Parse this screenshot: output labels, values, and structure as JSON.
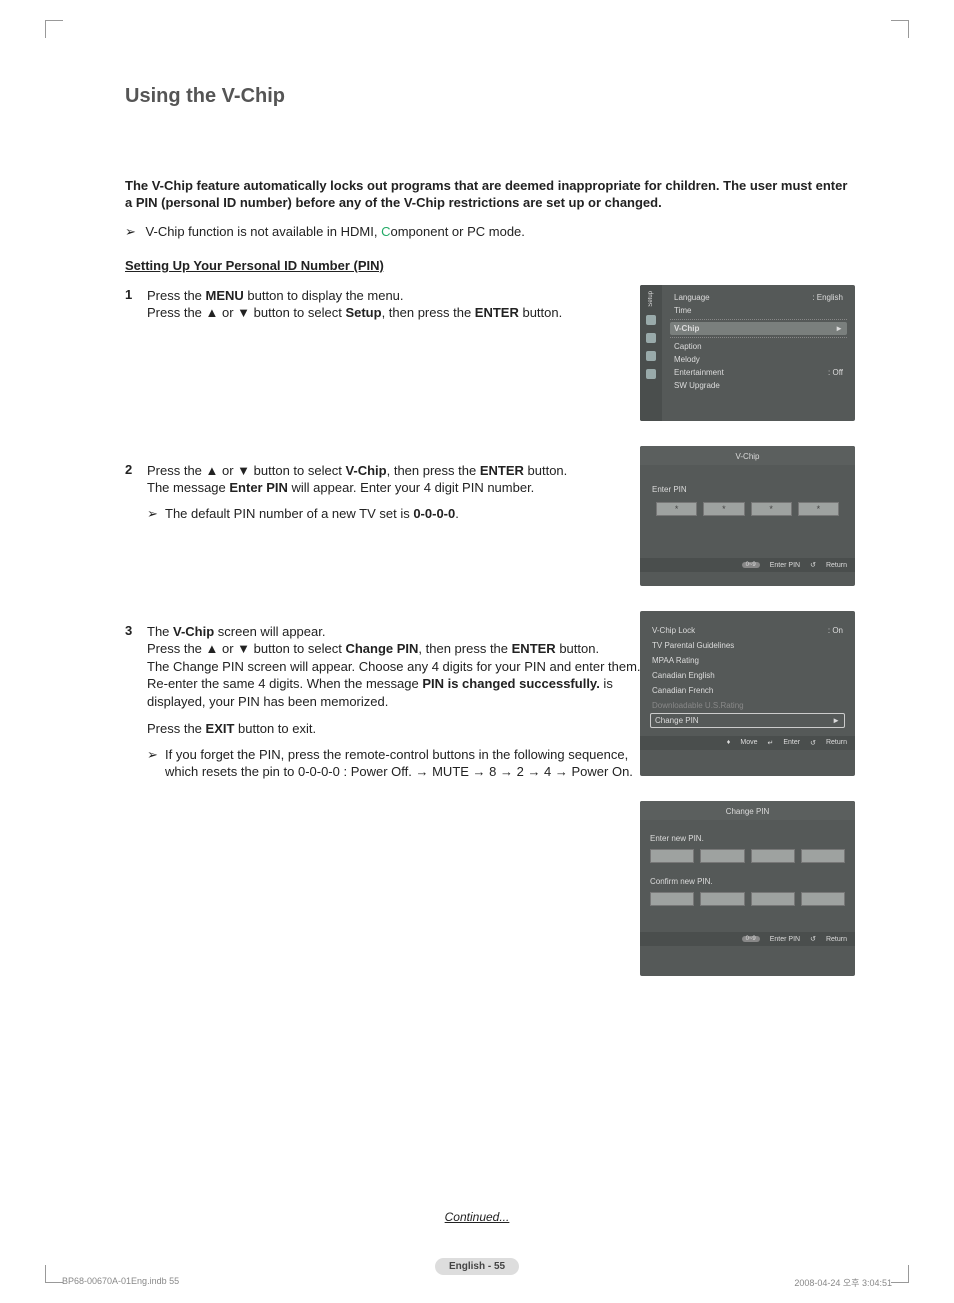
{
  "title": "Using the V-Chip",
  "intro": "The V-Chip feature automatically locks out programs that are deemed inappropriate for children. The user must enter a PIN (personal ID number) before any of the V-Chip restrictions are set up or changed.",
  "intro_note_pre": "V-Chip function is not available in HDMI, ",
  "intro_note_c": "C",
  "intro_note_post": "omponent or PC mode.",
  "section_heading": "Setting Up Your Personal ID Number (PIN)",
  "steps": {
    "s1": {
      "num": "1",
      "l1a": "Press the ",
      "l1b": "MENU",
      "l1c": " button to display the menu.",
      "l2a": "Press the ▲ or ▼ button to select ",
      "l2b": "Setup",
      "l2c": ", then press the ",
      "l2d": "ENTER",
      "l2e": " button."
    },
    "s2": {
      "num": "2",
      "l1a": "Press the ▲ or ▼ button to select ",
      "l1b": "V-Chip",
      "l1c": ", then press the ",
      "l1d": "ENTER",
      "l1e": " button.",
      "l2a": "The message ",
      "l2b": "Enter PIN",
      "l2c": " will appear. Enter your 4 digit PIN number.",
      "sub_a": "The default PIN number of a new TV set is ",
      "sub_b": "0-0-0-0",
      "sub_c": "."
    },
    "s3": {
      "num": "3",
      "l1a": "The ",
      "l1b": "V-Chip",
      "l1c": " screen will appear.",
      "l2a": "Press the ▲ or ▼ button to select ",
      "l2b": "Change PIN",
      "l2c": ", then press the ",
      "l2d": "ENTER",
      "l2e": " button.",
      "l3": "The Change PIN screen will appear. Choose any 4 digits for your PIN and enter them. Re-enter the same 4 digits. When the message ",
      "l3b": "PIN is changed successfully.",
      "l3c": " is displayed, your PIN has been memorized.",
      "l4a": "Press the ",
      "l4b": "EXIT",
      "l4c": " button to exit.",
      "sub": "If you forget the PIN, press the remote-control buttons in the following sequence, which resets the pin to 0-0-0-0 : Power Off. → MUTE → 8 → 2 → 4 → Power On."
    }
  },
  "screenA": {
    "side_label": "Setup",
    "rows": [
      {
        "k": "Language",
        "v": ": English"
      },
      {
        "k": "Time",
        "v": ""
      }
    ],
    "hl": "V-Chip",
    "rows2": [
      {
        "k": "Caption",
        "v": ""
      },
      {
        "k": "Melody",
        "v": ""
      },
      {
        "k": "Entertainment",
        "v": ": Off"
      },
      {
        "k": "SW Upgrade",
        "v": ""
      }
    ]
  },
  "screenB": {
    "title": "V-Chip",
    "enter_label": "Enter PIN",
    "star": "*",
    "f_09": "0~9",
    "f_enter": "Enter PIN",
    "f_ret": "Return"
  },
  "screenC": {
    "rows": [
      {
        "k": "V-Chip Lock",
        "v": ": On"
      },
      {
        "k": "TV Parental Guidelines",
        "v": ""
      },
      {
        "k": "MPAA Rating",
        "v": ""
      },
      {
        "k": "Canadian English",
        "v": ""
      },
      {
        "k": "Canadian French",
        "v": ""
      }
    ],
    "dis": "Downloadable U.S.Rating",
    "sel": "Change PIN",
    "f_move": "Move",
    "f_enter": "Enter",
    "f_ret": "Return"
  },
  "screenD": {
    "title": "Change PIN",
    "l1": "Enter new PIN.",
    "l2": "Confirm new PIN.",
    "f_09": "0~9",
    "f_enter": "Enter PIN",
    "f_ret": "Return"
  },
  "continued": "Continued...",
  "page_pill": "English - 55",
  "foot_left": "BP68-00670A-01Eng.indb   55",
  "foot_right": "2008-04-24   오후 3:04:51"
}
